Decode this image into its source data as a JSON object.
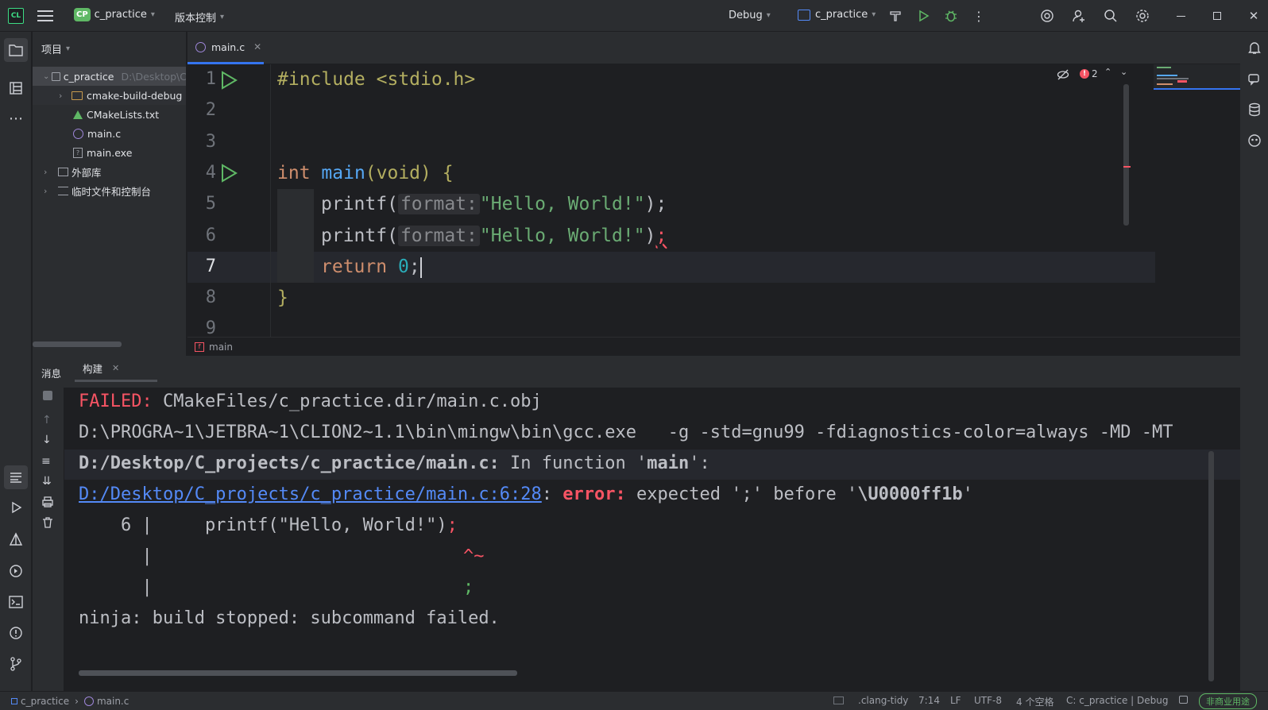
{
  "titlebar": {
    "project_badge": "CP",
    "project_name": "c_practice",
    "vcs": "版本控制",
    "config": "Debug",
    "run_target": "c_practice"
  },
  "project_panel": {
    "title": "项目",
    "root": "c_practice",
    "root_path": "D:\\Desktop\\C",
    "items": [
      {
        "label": "cmake-build-debug"
      },
      {
        "label": "CMakeLists.txt"
      },
      {
        "label": "main.c"
      },
      {
        "label": "main.exe"
      },
      {
        "label": "外部库"
      },
      {
        "label": "临时文件和控制台"
      }
    ]
  },
  "editor": {
    "tab": "main.c",
    "error_count": "2",
    "line_numbers": [
      "1",
      "2",
      "3",
      "4",
      "5",
      "6",
      "7",
      "8",
      "9"
    ],
    "lines": {
      "l1": "#include <stdio.h>",
      "l4_kw": "int",
      "l4_fn": "main",
      "l4_rest": "(void) {",
      "printf": "printf(",
      "hint": "format:",
      "str": "\"Hello, World!\"",
      "l5_end": ");",
      "l6_end": ")",
      "l6_semi": ";",
      "l7_kw": "return",
      "l7_num": "0",
      "l7_end": ";",
      "l8": "}"
    },
    "breadcrumb": "main"
  },
  "build": {
    "tabs": [
      "消息",
      "构建"
    ],
    "output": {
      "failed_label": "FAILED:",
      "failed_path": " CMakeFiles/c_practice.dir/main.c.obj",
      "cmd": "D:\\PROGRA~1\\JETBRA~1\\CLION2~1.1\\bin\\mingw\\bin\\gcc.exe   -g -std=gnu99 -fdiagnostics-color=always -MD -MT",
      "infile": "D:/Desktop/C_projects/c_practice/main.c:",
      "infunc": " In function '",
      "infunc_name": "main",
      "infunc_end": "':",
      "errlink": "D:/Desktop/C_projects/c_practice/main.c:6:28",
      "colon": ": ",
      "error_label": "error:",
      "error_msg": " expected ';' before '",
      "error_char": "\\U0000ff1b",
      "error_end": "'",
      "src_prefix": "    6 |     printf(\"Hello, World!\")",
      "src_semi": ";",
      "bar1": "      |",
      "caret": "^~",
      "bar2": "      |",
      "fix": ";",
      "ninja": "ninja: build stopped: subcommand failed."
    }
  },
  "statusbar": {
    "crumb_project": "c_practice",
    "crumb_file": "main.c",
    "lint": ".clang-tidy",
    "position": "7:14",
    "line_sep": "LF",
    "encoding": "UTF-8",
    "indent": "4 个空格",
    "context": "C: c_practice | Debug",
    "license": "非商业用途"
  }
}
